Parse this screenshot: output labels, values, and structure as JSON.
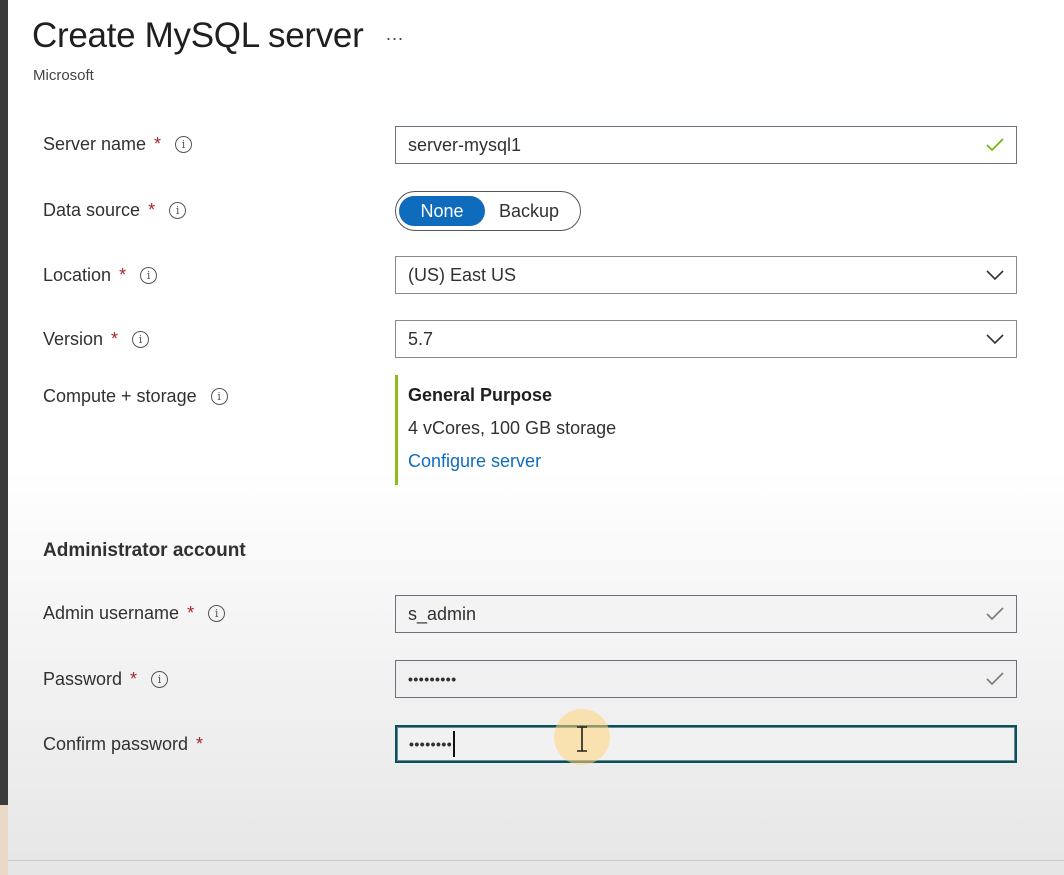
{
  "header": {
    "title": "Create MySQL server",
    "more_glyph": "...",
    "publisher": "Microsoft"
  },
  "form": {
    "server_name": {
      "label": "Server name",
      "required": "*",
      "value": "server-mysql1",
      "valid": true
    },
    "data_source": {
      "label": "Data source",
      "required": "*",
      "options": [
        "None",
        "Backup"
      ],
      "selected": "None"
    },
    "location": {
      "label": "Location",
      "required": "*",
      "value": "(US) East US"
    },
    "version": {
      "label": "Version",
      "required": "*",
      "value": "5.7"
    },
    "compute": {
      "label": "Compute + storage",
      "tier": "General Purpose",
      "spec": "4 vCores, 100 GB storage",
      "link": "Configure server"
    }
  },
  "admin": {
    "heading": "Administrator account",
    "username": {
      "label": "Admin username",
      "required": "*",
      "value": "s_admin",
      "valid": true
    },
    "password": {
      "label": "Password",
      "required": "*",
      "value": "•••••••••",
      "valid": true
    },
    "confirm": {
      "label": "Confirm password",
      "required": "*",
      "value": "••••••••"
    }
  },
  "icons": {
    "info": "i"
  },
  "colors": {
    "accent": "#0f6cbd",
    "required": "#a4262c",
    "check": "#6bb700",
    "compute_bar": "#8cbd18"
  }
}
